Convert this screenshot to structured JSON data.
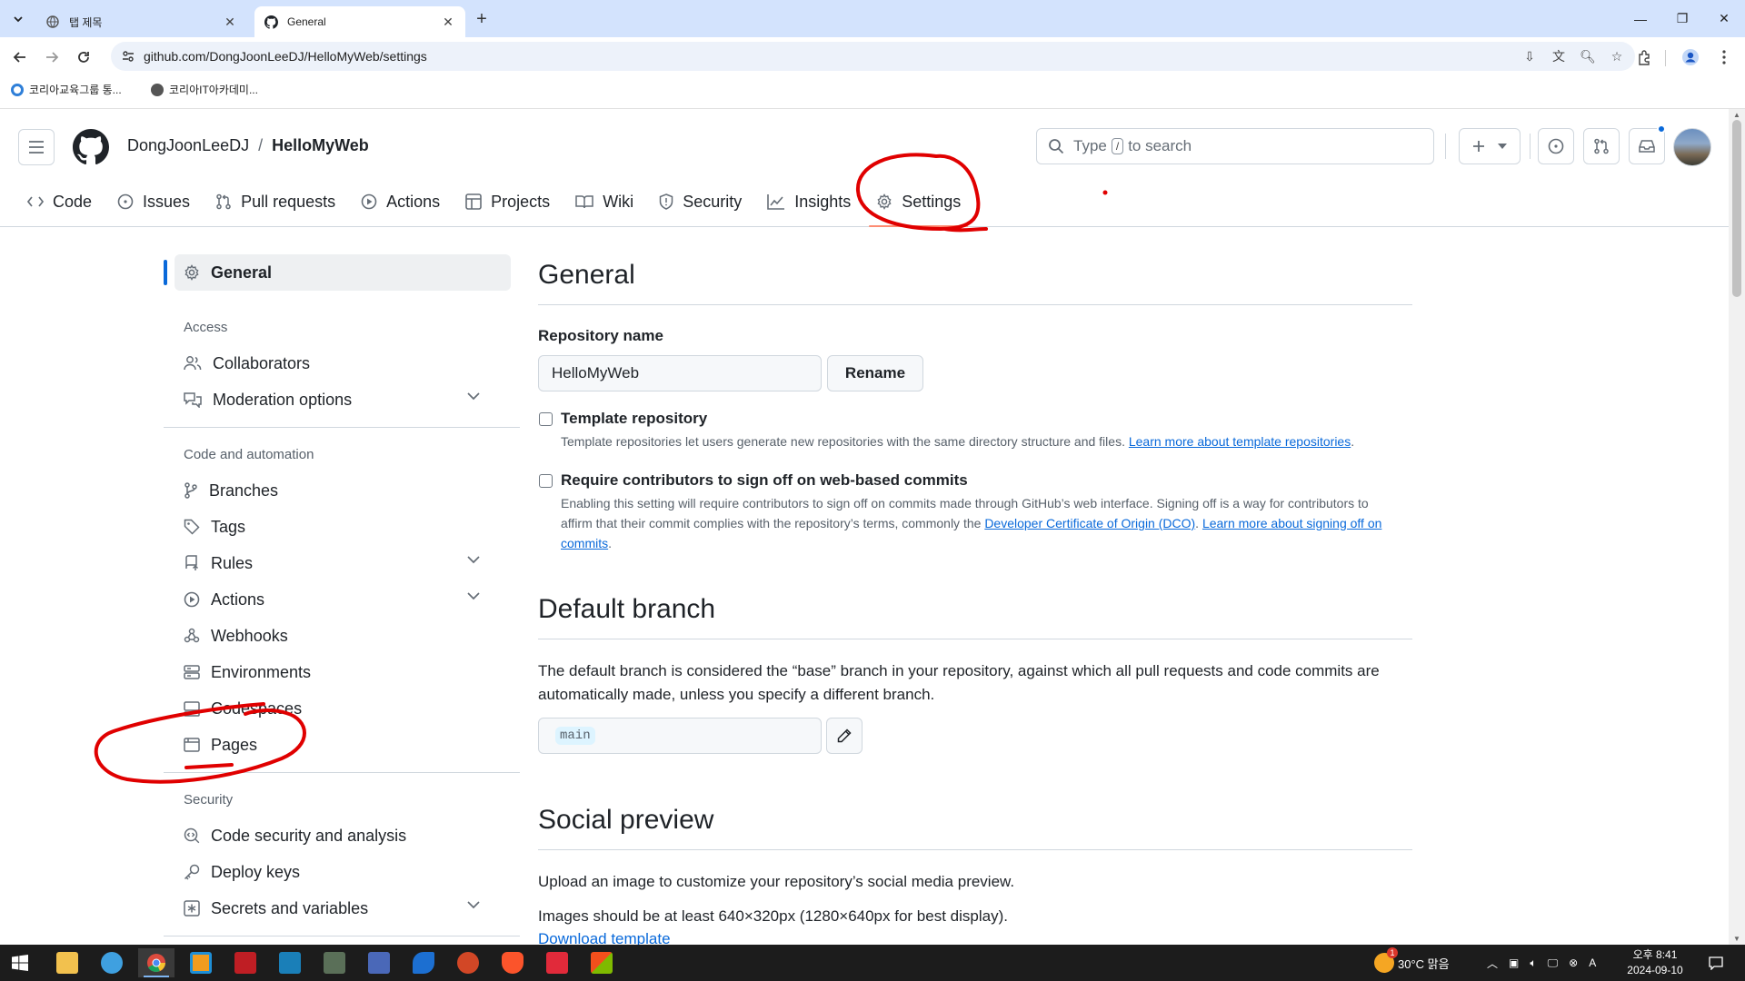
{
  "browser": {
    "tabs": [
      {
        "title": "탭 제목",
        "active": false
      },
      {
        "title": "General",
        "active": true
      }
    ],
    "url": "github.com/DongJoonLeeDJ/HelloMyWeb/settings",
    "bookmarks": [
      {
        "label": "코리아교육그룹 통..."
      },
      {
        "label": "코리아IT아카데미..."
      }
    ]
  },
  "github": {
    "owner": "DongJoonLeeDJ",
    "separator": "/",
    "repo": "HelloMyWeb",
    "search": {
      "before": "Type",
      "key": "/",
      "after": "to search"
    },
    "repo_nav": [
      {
        "label": "Code",
        "icon": "code-icon"
      },
      {
        "label": "Issues",
        "icon": "issue-icon"
      },
      {
        "label": "Pull requests",
        "icon": "pull-request-icon"
      },
      {
        "label": "Actions",
        "icon": "play-icon"
      },
      {
        "label": "Projects",
        "icon": "table-icon"
      },
      {
        "label": "Wiki",
        "icon": "book-icon"
      },
      {
        "label": "Security",
        "icon": "shield-icon"
      },
      {
        "label": "Insights",
        "icon": "graph-icon"
      },
      {
        "label": "Settings",
        "icon": "gear-icon",
        "selected": true
      }
    ]
  },
  "sidebar": {
    "general": "General",
    "access_heading": "Access",
    "access": [
      {
        "label": "Collaborators",
        "expandable": false
      },
      {
        "label": "Moderation options",
        "expandable": true
      }
    ],
    "code_heading": "Code and automation",
    "code": [
      {
        "label": "Branches",
        "expandable": false
      },
      {
        "label": "Tags",
        "expandable": false
      },
      {
        "label": "Rules",
        "expandable": true
      },
      {
        "label": "Actions",
        "expandable": true
      },
      {
        "label": "Webhooks",
        "expandable": false
      },
      {
        "label": "Environments",
        "expandable": false
      },
      {
        "label": "Codespaces",
        "expandable": false
      },
      {
        "label": "Pages",
        "expandable": false
      }
    ],
    "security_heading": "Security",
    "security": [
      {
        "label": "Code security and analysis",
        "expandable": false
      },
      {
        "label": "Deploy keys",
        "expandable": false
      },
      {
        "label": "Secrets and variables",
        "expandable": true
      }
    ]
  },
  "main": {
    "title": "General",
    "repo_name_label": "Repository name",
    "repo_name_value": "HelloMyWeb",
    "rename_button": "Rename",
    "template": {
      "title": "Template repository",
      "desc": "Template repositories let users generate new repositories with the same directory structure and files.",
      "link": "Learn more about template repositories",
      "end": "."
    },
    "signoff": {
      "title": "Require contributors to sign off on web-based commits",
      "desc1": "Enabling this setting will require contributors to sign off on commits made through GitHub’s web interface. Signing off is a way for contributors to affirm that their commit complies with the repository’s terms, commonly the",
      "link1": "Developer Certificate of Origin (DCO)",
      "mid": ".",
      "link2": "Learn more about signing off on commits",
      "end": "."
    },
    "default_branch": {
      "title": "Default branch",
      "desc": "The default branch is considered the “base” branch in your repository, against which all pull requests and code commits are automatically made, unless you specify a different branch.",
      "branch": "main"
    },
    "social": {
      "title": "Social preview",
      "desc": "Upload an image to customize your repository’s social media preview.",
      "desc2": "Images should be at least 640×320px (1280×640px for best display).",
      "link": "Download template"
    }
  },
  "taskbar": {
    "weather": "30°C  맑음",
    "weather_badge": "1",
    "ime": "A",
    "time": "오후 8:41",
    "date": "2024-09-10"
  },
  "colors": {
    "annotation_red": "#e00000",
    "link_blue": "#0969da",
    "underline_orange": "#fd8c73"
  }
}
